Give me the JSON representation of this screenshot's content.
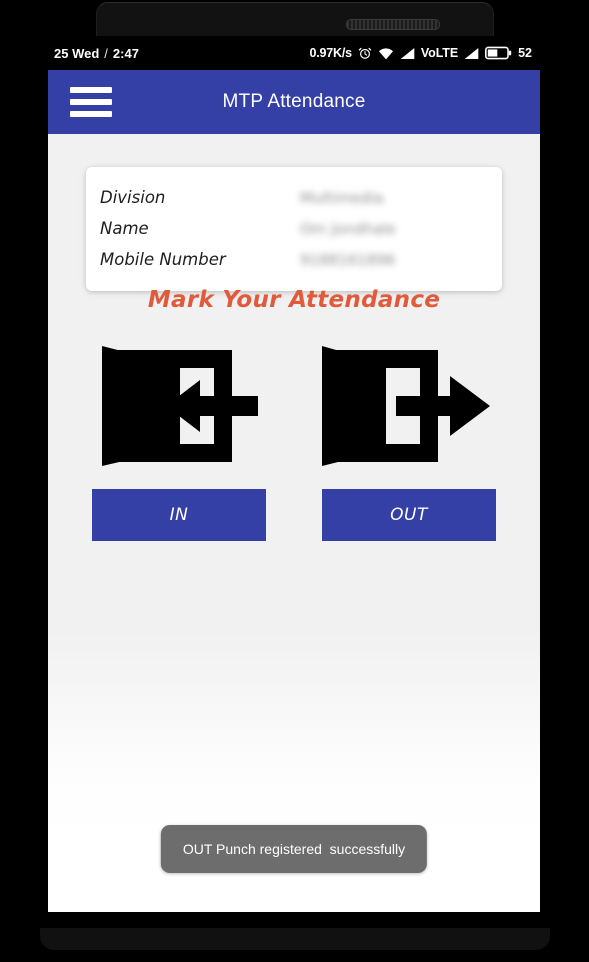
{
  "status_bar": {
    "date": "25 Wed",
    "separator": "/",
    "time": "2:47",
    "network_speed": "0.97K/s",
    "alarm_icon": "alarm-clock-icon",
    "wifi_icon": "wifi-icon",
    "signal_icon_1": "signal-bars-icon",
    "volte_label": "VoLTE",
    "signal_icon_2": "signal-bars-icon",
    "battery_icon": "battery-icon",
    "battery_level": "52"
  },
  "app_bar": {
    "menu_icon": "hamburger-menu-icon",
    "title": "MTP Attendance",
    "color": "#3440a5"
  },
  "info_card": {
    "rows": [
      {
        "label": "Division",
        "value": "Multimedia"
      },
      {
        "label": "Name",
        "value": "Om Jondhale"
      },
      {
        "label": "Mobile Number",
        "value": "9188161896"
      }
    ]
  },
  "main": {
    "heading": "Mark Your Attendance",
    "heading_color": "#e05a3c",
    "actions": [
      {
        "icon": "door-enter-icon",
        "label": "IN"
      },
      {
        "icon": "door-exit-icon",
        "label": "OUT"
      }
    ],
    "button_color": "#3440a5"
  },
  "toast": {
    "message": "OUT Punch registered  successfully",
    "background": "#6d6d6d"
  }
}
